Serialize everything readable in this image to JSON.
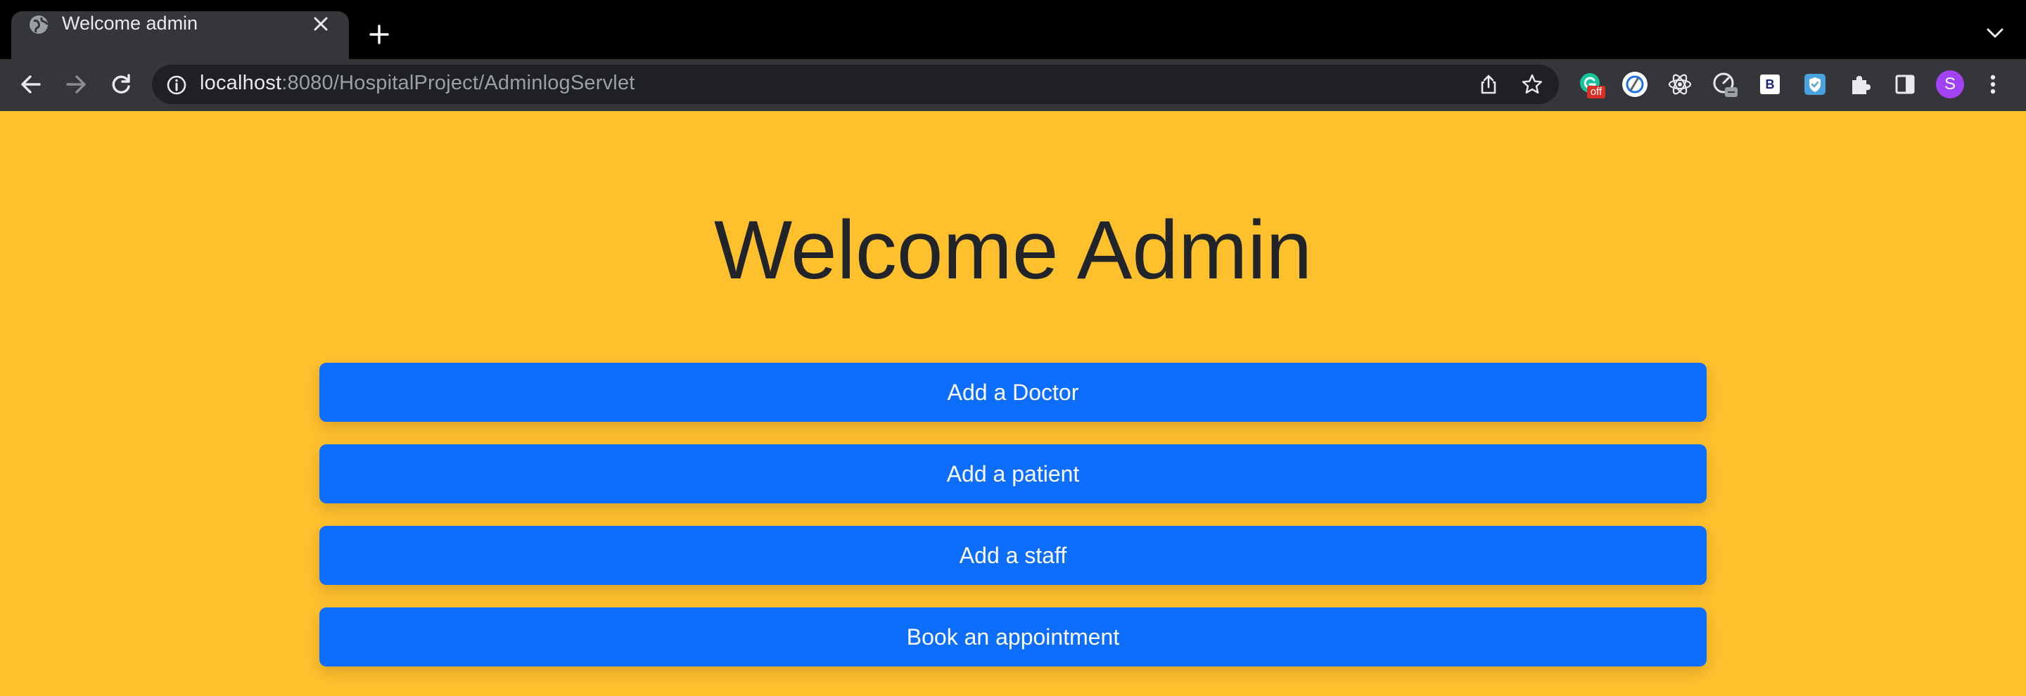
{
  "browser": {
    "tab": {
      "title": "Welcome admin",
      "favicon_icon": "globe-icon",
      "close_icon": "close-icon"
    },
    "new_tab_icon": "plus-icon",
    "tab_search_icon": "chevron-down-icon",
    "nav": {
      "back_icon": "back-arrow-icon",
      "forward_icon": "forward-arrow-icon",
      "reload_icon": "reload-icon"
    },
    "address_bar": {
      "site_info_icon": "info-icon",
      "host": "localhost",
      "rest": ":8080/HospitalProject/AdminlogServlet",
      "share_icon": "share-icon",
      "bookmark_icon": "star-icon"
    },
    "extensions": {
      "grammarly_badge": "off",
      "bootstrap_label": "B",
      "profile_initial": "S"
    }
  },
  "page": {
    "heading": "Welcome Admin",
    "buttons": [
      {
        "label": "Add a Doctor"
      },
      {
        "label": "Add a patient"
      },
      {
        "label": "Add a staff"
      },
      {
        "label": "Book an appointment"
      }
    ]
  },
  "colors": {
    "page_background": "#ffc02e",
    "button_primary": "#0d6efd",
    "heading_text": "#212529",
    "chrome_tab": "#35363a",
    "chrome_tabbar": "#000000",
    "omnibox": "#202124"
  }
}
